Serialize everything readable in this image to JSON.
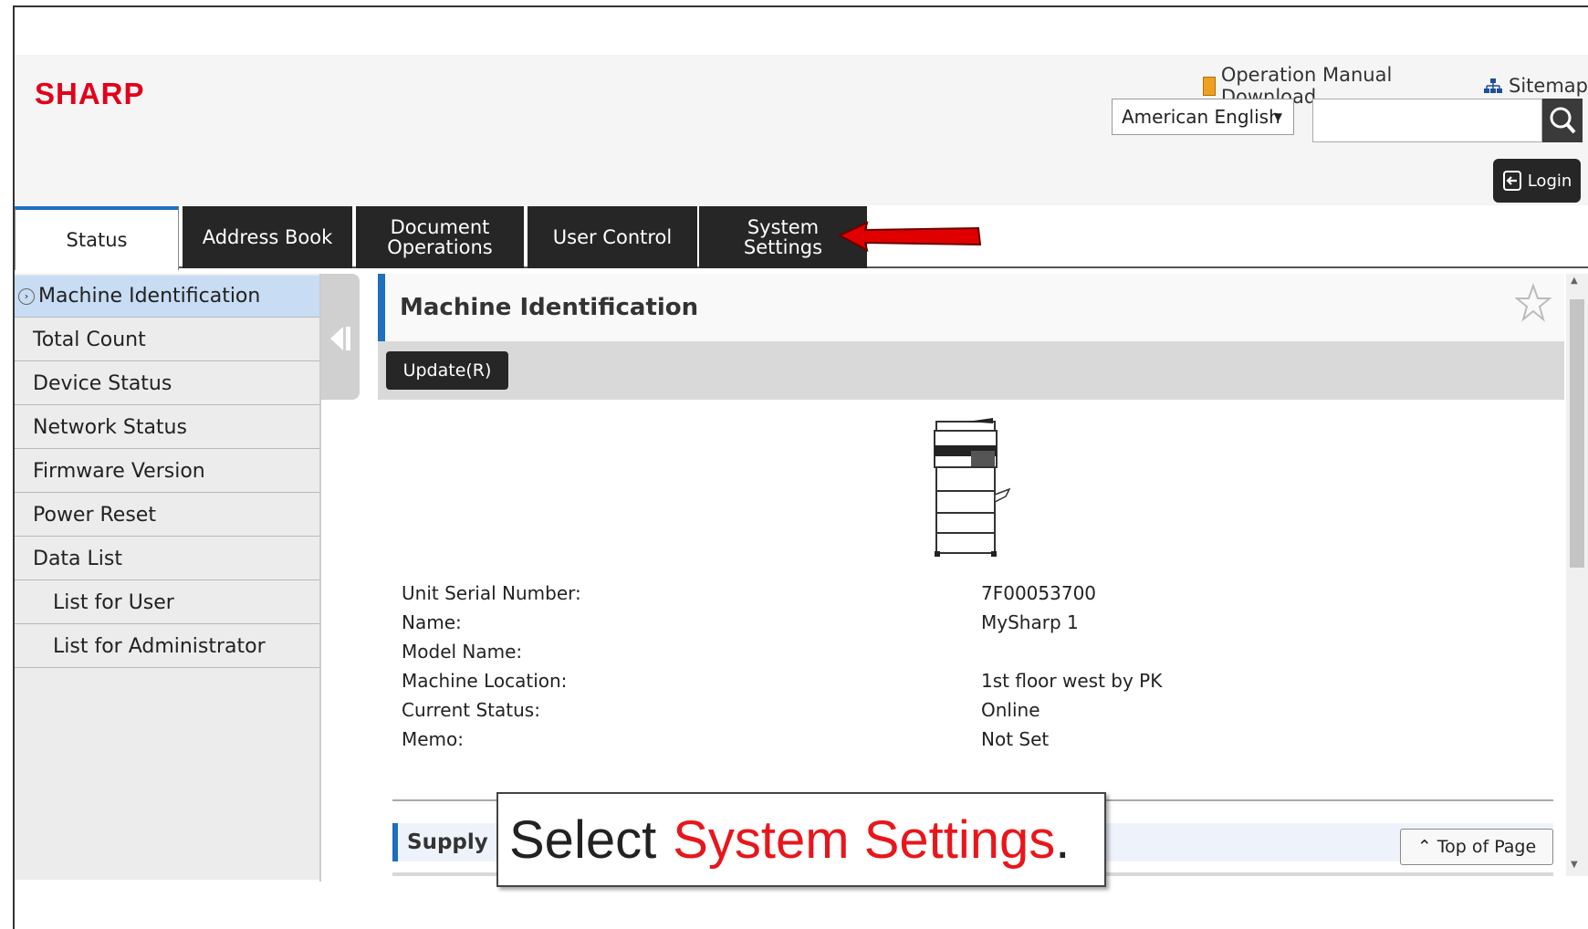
{
  "brand": {
    "logo": "SHARP",
    "logo_color": "#e2001a"
  },
  "top_links": {
    "manual": "Operation Manual Download",
    "sitemap": "Sitemap"
  },
  "language": {
    "selected": "American English"
  },
  "search": {
    "value": ""
  },
  "login": {
    "label": "Login"
  },
  "tabs": [
    {
      "label": "Status",
      "active": true
    },
    {
      "label": "Address Book"
    },
    {
      "label": "Document\nOperations"
    },
    {
      "label": "User Control"
    },
    {
      "label": "System\nSettings"
    }
  ],
  "sidebar": {
    "items": [
      {
        "label": "Machine Identification",
        "active": true
      },
      {
        "label": "Total Count"
      },
      {
        "label": "Device Status"
      },
      {
        "label": "Network Status"
      },
      {
        "label": "Firmware Version"
      },
      {
        "label": "Power Reset"
      },
      {
        "label": "Data List"
      },
      {
        "label": "List for User",
        "sub": true
      },
      {
        "label": "List for Administrator",
        "sub": true
      }
    ]
  },
  "main": {
    "title": "Machine Identification",
    "update_button": "Update(R)",
    "fields": [
      {
        "label": "Unit Serial Number:",
        "value": "7F00053700"
      },
      {
        "label": "Name:",
        "value": "MySharp 1"
      },
      {
        "label": "Model Name:",
        "value": ""
      },
      {
        "label": "Machine Location:",
        "value": "1st floor west by PK"
      },
      {
        "label": "Current Status:",
        "value": "Online"
      },
      {
        "label": "Memo:",
        "value": "Not Set"
      }
    ],
    "supply_title": "Supply S",
    "top_of_page": "Top of Page"
  },
  "callout": {
    "prefix": "Select",
    "highlight": "System Settings",
    "suffix": "."
  },
  "colors": {
    "accent": "#1e6fbf",
    "tab_dark": "#262626",
    "callout_highlight": "#e8161b",
    "arrow": "#e00000"
  }
}
